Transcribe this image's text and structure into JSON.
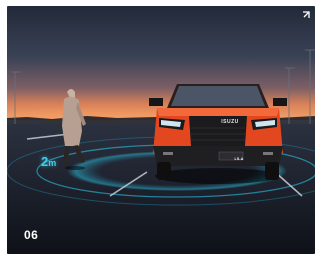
{
  "slide": {
    "number": "06",
    "distance_value": "2",
    "distance_unit": "m",
    "grille_logo": "ISUZU",
    "badge": "LS-A"
  },
  "icons": {
    "expand": "expand-corners-icon"
  },
  "colors": {
    "sensor_cyan": "#3fd0ea",
    "truck_orange": "#e3471f",
    "sky_top": "#232b3b",
    "horizon_glow": "#e07a4c"
  }
}
